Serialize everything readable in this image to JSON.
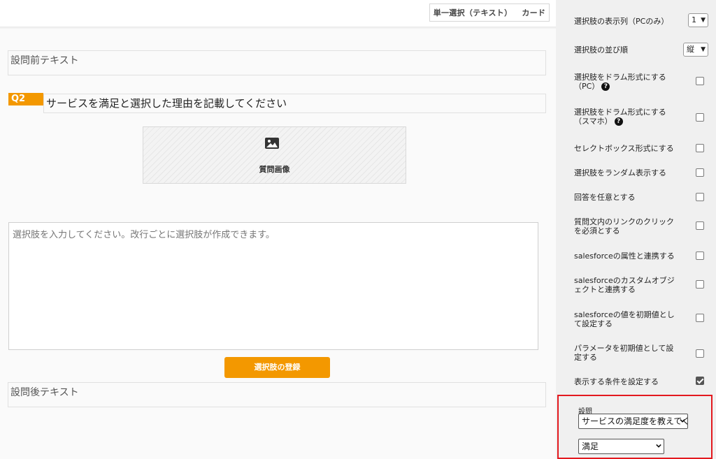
{
  "main": {
    "type_chip": {
      "type": "単一選択（テキスト）",
      "view": "カード"
    },
    "pre_text_placeholder": "設問前テキスト",
    "question": {
      "badge": "Q2",
      "title": "サービスを満足と選択した理由を記載してください"
    },
    "image_label": "質問画像",
    "choices_placeholder": "選択肢を入力してください。改行ごとに選択肢が作成できます。",
    "register_button": "選択肢の登録",
    "post_text_placeholder": "設問後テキスト"
  },
  "sidebar": {
    "columns": {
      "label": "選択肢の表示列（PCのみ）",
      "value": "1"
    },
    "order": {
      "label": "選択肢の並び順",
      "value": "縦"
    },
    "options": [
      {
        "label": "選択肢をドラム形式にする（PC）",
        "help": true,
        "checked": false
      },
      {
        "label": "選択肢をドラム形式にする（スマホ）",
        "help": true,
        "checked": false
      },
      {
        "label": "セレクトボックス形式にする",
        "help": false,
        "checked": false
      },
      {
        "label": "選択肢をランダム表示する",
        "help": false,
        "checked": false
      },
      {
        "label": "回答を任意とする",
        "help": false,
        "checked": false
      },
      {
        "label": "質問文内のリンクのクリックを必須とする",
        "help": false,
        "checked": false
      },
      {
        "label": "salesforceの属性と連携する",
        "help": false,
        "checked": false
      },
      {
        "label": "salesforceのカスタムオブジェクトと連携する",
        "help": false,
        "checked": false
      },
      {
        "label": "salesforceの値を初期値として設定する",
        "help": false,
        "checked": false
      },
      {
        "label": "パラメータを初期値として設定する",
        "help": false,
        "checked": false
      },
      {
        "label": "表示する条件を設定する",
        "help": false,
        "checked": true
      }
    ],
    "condition": {
      "label": "設問",
      "question_select": "サービスの満足度を教えてください",
      "answer_select": "満足"
    }
  },
  "colors": {
    "accent": "#f39800",
    "highlight_border": "#e3191f"
  }
}
